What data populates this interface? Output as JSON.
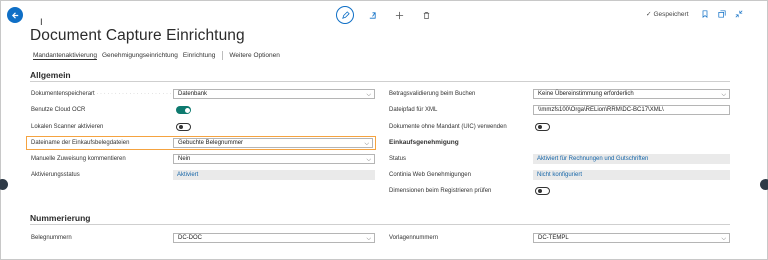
{
  "page": {
    "title": "Document Capture Einrichtung",
    "cursor_char": "I"
  },
  "header": {
    "saved_label": "Gespeichert",
    "icons": [
      "back-arrow-icon",
      "edit-icon",
      "share-icon",
      "new-icon",
      "delete-icon",
      "bookmark-icon",
      "open-new-window-icon",
      "collapse-icon"
    ]
  },
  "tabs": [
    "Mandantenaktivierung",
    "Genehmigungseinrichtung",
    "Einrichtung",
    "Weitere Optionen"
  ],
  "sections": {
    "allgemein": {
      "title": "Allgemein"
    },
    "nummerierung": {
      "title": "Nummerierung"
    }
  },
  "left_fields": {
    "dokumentenspeicherart": {
      "label": "Dokumentenspeicherart",
      "value": "Datenbank"
    },
    "cloud_ocr": {
      "label": "Benutze Cloud OCR",
      "state": "on"
    },
    "lokalen_scanner": {
      "label": "Lokalen Scanner aktivieren",
      "state": "off"
    },
    "dateiname": {
      "label": "Dateiname der Einkaufsbelegdateien",
      "value": "Gebuchte Belegnummer"
    },
    "manuelle_zuweisung": {
      "label": "Manuelle Zuweisung kommentieren",
      "value": "Nein"
    },
    "aktivierungsstatus": {
      "label": "Aktivierungsstatus",
      "value": "Aktiviert"
    }
  },
  "right_fields": {
    "betragsvalidierung": {
      "label": "Betragsvalidierung beim Buchen",
      "value": "Keine Übereinstimmung erforderlich"
    },
    "dateipfad": {
      "label": "Dateipfad für XML",
      "value": "\\\\mmzfs100\\Orga\\RELion\\RRM\\DC-BC17\\XML\\"
    },
    "ohne_mandant": {
      "label": "Dokumente ohne Mandant (UIC) verwenden",
      "state": "off"
    },
    "einkaufsgenehmigung": "Einkaufsgenehmigung",
    "status": {
      "label": "Status",
      "value": "Aktiviert für Rechnungen und Gutschriften"
    },
    "continia": {
      "label": "Continia Web Genehmigungen",
      "value": "Nicht konfiguriert"
    },
    "dimensionen": {
      "label": "Dimensionen beim Registrieren prüfen",
      "state": "off"
    }
  },
  "numbering": {
    "belegnummern": {
      "label": "Belegnummern",
      "value": "DC-DOC"
    },
    "vorlagennummern": {
      "label": "Vorlagennummern",
      "value": "DC-TEMPL"
    }
  },
  "colors": {
    "accent": "#0f6fc6",
    "toggle_on": "#0e7a6f",
    "highlight": "#f5a340"
  }
}
